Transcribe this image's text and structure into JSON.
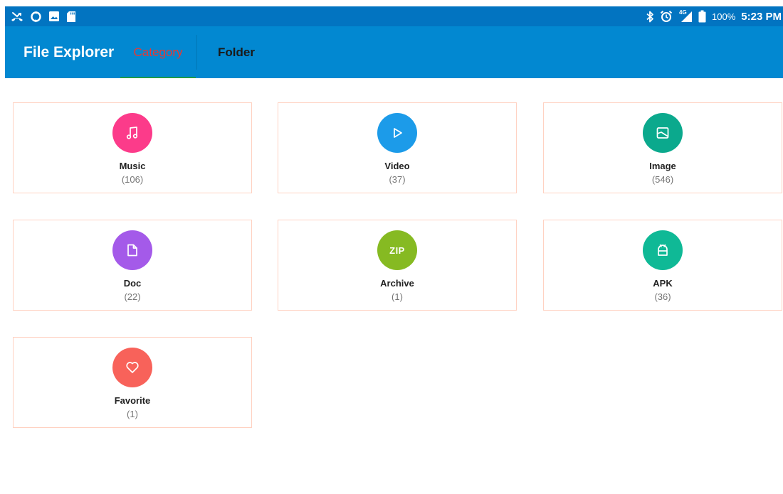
{
  "status_bar": {
    "battery_text": "100%",
    "time": "5:23 PM",
    "network_text": "4G",
    "left_icons": [
      "missed-call-icon",
      "sync-icon",
      "image-icon",
      "sd-card-icon"
    ],
    "right_icons": [
      "bluetooth-icon",
      "alarm-icon",
      "signal-4g-icon",
      "battery-icon"
    ]
  },
  "app_bar": {
    "title": "File Explorer",
    "tabs": [
      {
        "label": "Category",
        "selected": true
      },
      {
        "label": "Folder",
        "selected": false
      }
    ]
  },
  "categories": [
    {
      "label": "Music",
      "count": "(106)",
      "color": "#fc3b8a",
      "icon": "music-icon"
    },
    {
      "label": "Video",
      "count": "(37)",
      "color": "#1c9be9",
      "icon": "play-icon"
    },
    {
      "label": "Image",
      "count": "(546)",
      "color": "#0ba98d",
      "icon": "image-icon"
    },
    {
      "label": "Doc",
      "count": "(22)",
      "color": "#a45ae9",
      "icon": "document-icon"
    },
    {
      "label": "Archive",
      "count": "(1)",
      "color": "#86ba22",
      "icon": "zip-icon",
      "icon_text": "ZIP"
    },
    {
      "label": "APK",
      "count": "(36)",
      "color": "#0fb996",
      "icon": "android-icon"
    },
    {
      "label": "Favorite",
      "count": "(1)",
      "color": "#f8625a",
      "icon": "heart-icon"
    }
  ],
  "colors": {
    "status_bar": "#0274c1",
    "app_bar": "#0288d1",
    "selected_tab_text": "#e53935",
    "tab_indicator": "#1e9a4a",
    "card_border": "#ffd2c2"
  }
}
